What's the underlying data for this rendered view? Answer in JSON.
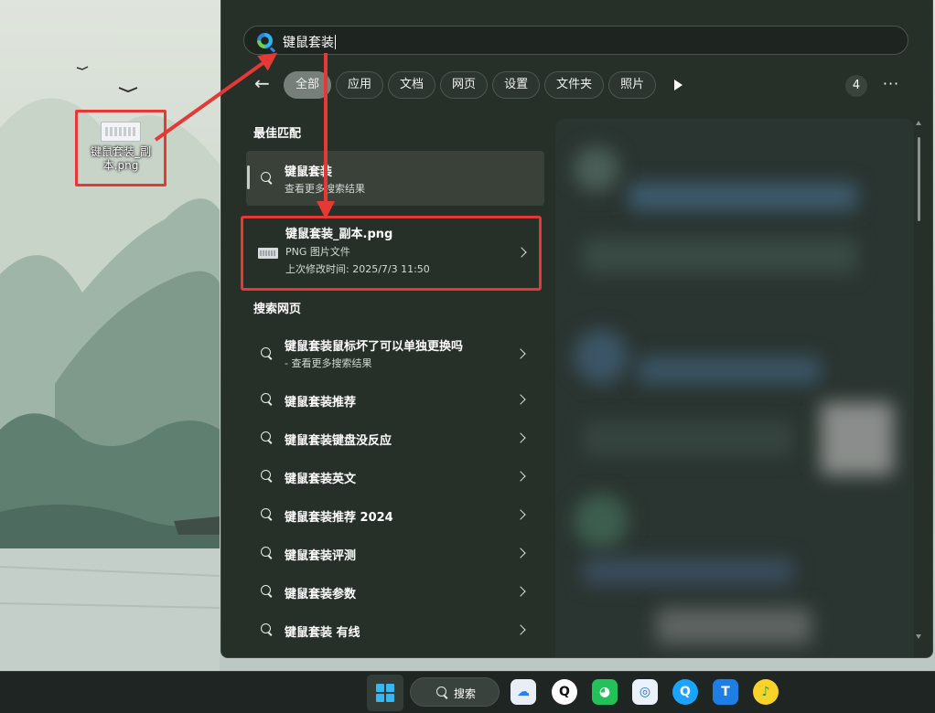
{
  "desktop": {
    "file_icon_label": "键鼠套装_副本.png"
  },
  "search": {
    "query": "键鼠套装"
  },
  "filters": {
    "back_label": "←",
    "chips": [
      "全部",
      "应用",
      "文档",
      "网页",
      "设置",
      "文件夹",
      "照片"
    ],
    "active_index": 0,
    "count": "4",
    "more_label": "···"
  },
  "best_match": {
    "section_title": "最佳匹配",
    "title": "键鼠套装",
    "subtitle": "查看更多搜索结果"
  },
  "file_result": {
    "title": "键鼠套装_副本.png",
    "type": "PNG 图片文件",
    "modified": "上次修改时间: 2025/7/3 11:50"
  },
  "web": {
    "section_title": "搜索网页",
    "top_item": {
      "title": "键鼠套装鼠标坏了可以单独更换吗",
      "subtitle": "- 查看更多搜索结果"
    },
    "items": [
      "键鼠套装推荐",
      "键鼠套装键盘没反应",
      "键鼠套装英文",
      "键鼠套装推荐 2024",
      "键鼠套装评测",
      "键鼠套装参数",
      "键鼠套装 有线"
    ]
  },
  "taskbar": {
    "search_label": "搜索",
    "apps": [
      "baidu-netdisk-icon",
      "qq-icon",
      "wechat-icon",
      "tencent-meeting-icon",
      "quark-browser-icon",
      "task-app-icon",
      "qq-music-icon"
    ]
  },
  "colors": {
    "annotation_red": "#e53935",
    "panel_bg": "#263029",
    "chip_active": "#767f79"
  }
}
